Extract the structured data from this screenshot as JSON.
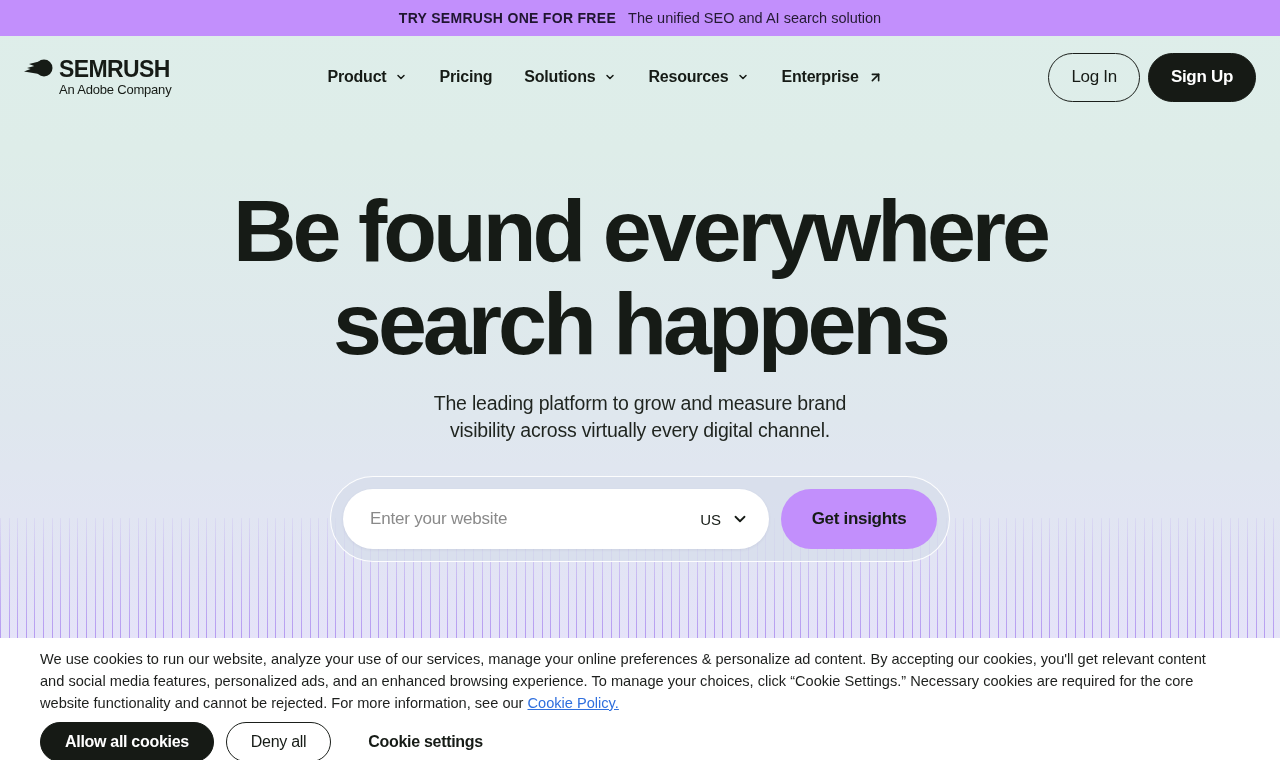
{
  "promo_banner": {
    "headline": "TRY SEMRUSH ONE FOR FREE",
    "tagline": "The unified SEO and AI search solution"
  },
  "header": {
    "logo": {
      "wordmark": "SEMRUSH",
      "subline": "An Adobe Company"
    },
    "nav": [
      {
        "label": "Product",
        "kind": "dropdown"
      },
      {
        "label": "Pricing",
        "kind": "link"
      },
      {
        "label": "Solutions",
        "kind": "dropdown"
      },
      {
        "label": "Resources",
        "kind": "dropdown"
      },
      {
        "label": "Enterprise",
        "kind": "external"
      }
    ],
    "actions": [
      {
        "label": "Log In",
        "kind": "outline"
      },
      {
        "label": "Sign Up",
        "kind": "solid"
      }
    ]
  },
  "hero": {
    "headline": "Be found everywhere search happens",
    "subtitle": "The leading platform to grow and measure brand visibility across virtually every digital channel.",
    "search": {
      "placeholder": "Enter your website",
      "country": "US",
      "button": "Get insights"
    }
  },
  "cookie_banner": {
    "text": "We use cookies to run our website, analyze your use of our services, manage your online preferences & personalize ad content. By accepting our cookies, you'll get relevant content and social media features, personalized ads, and an enhanced browsing experience. To manage your choices, click “Cookie Settings.” Necessary cookies are required for the core website functionality and cannot be rejected. For more information, see our",
    "link": "Cookie Policy.",
    "buttons": [
      {
        "label": "Allow all cookies",
        "kind": "solid"
      },
      {
        "label": "Deny all",
        "kind": "outline"
      },
      {
        "label": "Cookie settings",
        "kind": "text"
      }
    ]
  }
}
